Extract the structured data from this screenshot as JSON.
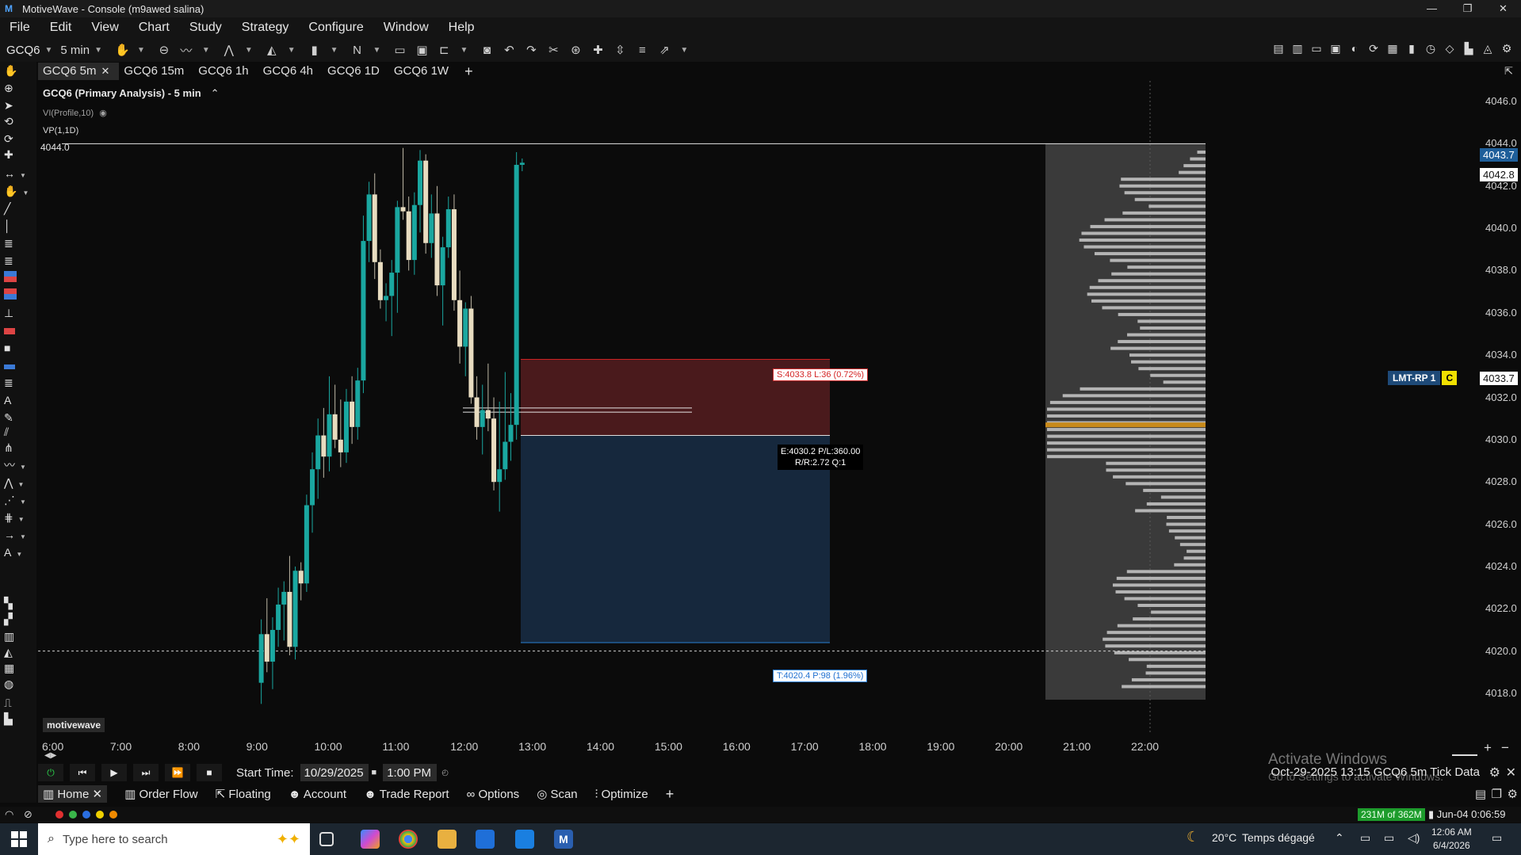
{
  "window": {
    "title": "MotiveWave - Console (m9awed salina)",
    "app_icon": "motivewave-logo-icon"
  },
  "menu": [
    "File",
    "Edit",
    "View",
    "Chart",
    "Study",
    "Strategy",
    "Configure",
    "Window",
    "Help"
  ],
  "toolbar": {
    "symbol": "GCQ6",
    "interval": "5 min",
    "bar_type_label": "N"
  },
  "tabs": [
    {
      "label": "GCQ6 5m",
      "active": true
    },
    {
      "label": "GCQ6 15m"
    },
    {
      "label": "GCQ6 1h"
    },
    {
      "label": "GCQ6 4h"
    },
    {
      "label": "GCQ6 1D"
    },
    {
      "label": "GCQ6 1W"
    }
  ],
  "chart": {
    "title": "GCQ6 (Primary Analysis) - 5 min",
    "study1": "VI(Profile,10)",
    "study2": "VP(1,1D)",
    "top_label": "4044.0",
    "watermark": "motivewave",
    "stop_label": "S:4033.8 L:36 (0.72%)",
    "entry_label_1": "E:4030.2 P/L:360.00",
    "entry_label_2": "R/R:2.72 Q:1",
    "target_label": "T:4020.4 P:98 (1.96%)",
    "lmt_label": "LMT-RP 1",
    "lmt_c": "C",
    "price_tags": [
      "4043.7",
      "4042.8",
      "4033.7"
    ],
    "y_axis": [
      "4046.0",
      "4044.0",
      "4042.0",
      "4040.0",
      "4038.0",
      "4036.0",
      "4034.0",
      "4032.0",
      "4030.0",
      "4028.0",
      "4026.0",
      "4024.0",
      "4022.0",
      "4020.0",
      "4018.0"
    ],
    "x_axis": [
      "6:00",
      "7:00",
      "8:00",
      "9:00",
      "10:00",
      "11:00",
      "12:00",
      "13:00",
      "14:00",
      "15:00",
      "16:00",
      "17:00",
      "18:00",
      "19:00",
      "20:00",
      "21:00",
      "22:00"
    ],
    "colors": {
      "up": "#1aa7a0",
      "down": "#e8dcc0",
      "stop_zone": "#4a1a1c",
      "target_zone": "#16283d",
      "poc": "#c88a1a"
    }
  },
  "playback": {
    "start_time_label": "Start Time:",
    "date": "10/29/2025",
    "time": "1:00 PM",
    "right_status": "Oct-29-2025 13:15  GCQ6 5m  Tick Data"
  },
  "bottom_nav": [
    "Home",
    "Order Flow",
    "Floating",
    "Account",
    "Trade Report",
    "Options",
    "Scan",
    "Optimize"
  ],
  "activate": {
    "line1": "Activate Windows",
    "line2": "Go to Settings to activate Windows."
  },
  "status": {
    "memory": "231M of 362M",
    "datetime": "Jun-04 0:06:59"
  },
  "taskbar": {
    "search_placeholder": "Type here to search",
    "weather_temp": "20°C",
    "weather_desc": "Temps dégagé",
    "time": "12:06 AM",
    "date": "6/4/2026"
  }
}
